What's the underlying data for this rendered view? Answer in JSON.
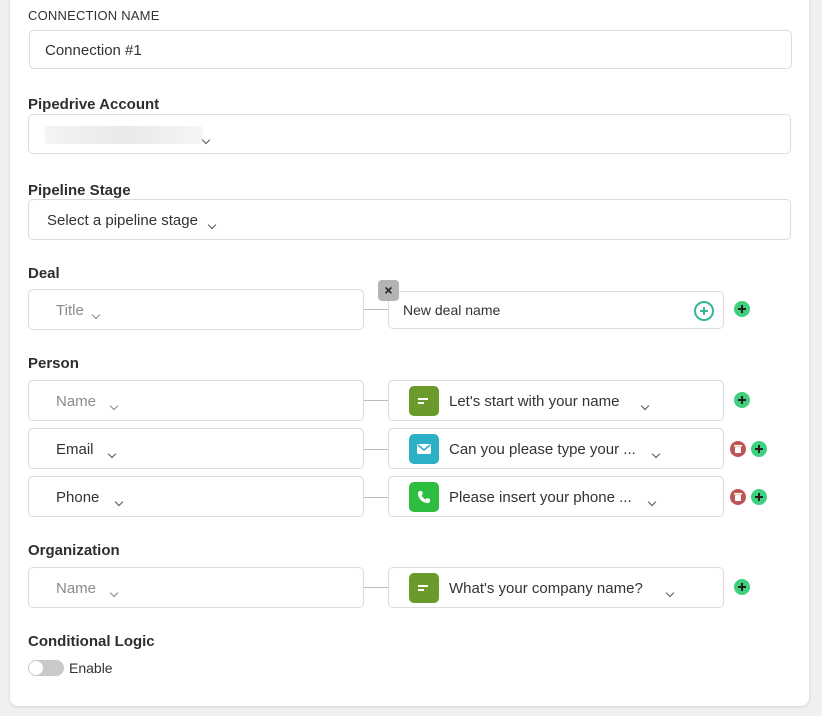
{
  "connection": {
    "label": "CONNECTION NAME",
    "value": "Connection #1"
  },
  "account": {
    "label": "Pipedrive Account"
  },
  "pipeline": {
    "label": "Pipeline Stage",
    "value": "Select a pipeline stage"
  },
  "deal": {
    "label": "Deal",
    "field": "Title",
    "input_value": "New deal name",
    "remove_glyph": "×"
  },
  "person": {
    "label": "Person",
    "rows": [
      {
        "field": "Name",
        "question": "Let's start with your name",
        "icon": "short-text-icon",
        "icon_color": "#6a9a2c"
      },
      {
        "field": "Email",
        "question": "Can you please type your ...",
        "icon": "email-icon",
        "icon_color": "#2bb0c6"
      },
      {
        "field": "Phone",
        "question": "Please insert your phone ...",
        "icon": "phone-icon",
        "icon_color": "#2dbe3f"
      }
    ]
  },
  "organization": {
    "label": "Organization",
    "field": "Name",
    "question": "What's your company name?",
    "icon": "short-text-icon",
    "icon_color": "#6a9a2c"
  },
  "conditional_logic": {
    "label": "Conditional Logic",
    "toggle_label": "Enable",
    "enabled": false
  },
  "colors": {
    "add": "#3ecf7f",
    "delete": "#c05555",
    "accent": "#3ab59a"
  }
}
